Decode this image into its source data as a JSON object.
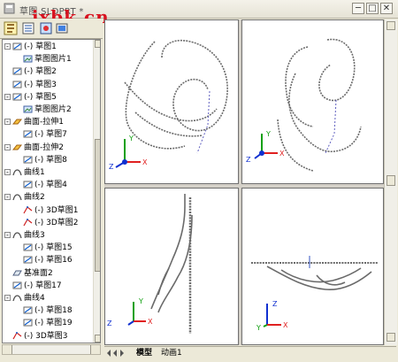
{
  "window": {
    "title": "草图.SLDPRT *",
    "watermark": "jxbk.cn",
    "minimize_label": "─",
    "restore_label": "□",
    "close_label": "✕"
  },
  "toolbar": {
    "buttons": [
      "feature-manager",
      "property-manager",
      "configuration-manager"
    ]
  },
  "tree": {
    "items": [
      {
        "label": "(-) 草图1",
        "icon": "sketch-icon",
        "level": 0,
        "expander": "-"
      },
      {
        "label": "草图图片1",
        "icon": "sketch-picture-icon",
        "level": 1
      },
      {
        "label": "(-) 草图2",
        "icon": "sketch-icon",
        "level": 0
      },
      {
        "label": "(-) 草图3",
        "icon": "sketch-icon",
        "level": 0
      },
      {
        "label": "(-) 草图5",
        "icon": "sketch-icon",
        "level": 0,
        "expander": "-"
      },
      {
        "label": "草图图片2",
        "icon": "sketch-picture-icon",
        "level": 1
      },
      {
        "label": "曲面-拉伸1",
        "icon": "surface-extrude-icon",
        "level": 0,
        "expander": "-"
      },
      {
        "label": "(-) 草图7",
        "icon": "sketch-icon",
        "level": 1
      },
      {
        "label": "曲面-拉伸2",
        "icon": "surface-extrude-icon",
        "level": 0,
        "expander": "-"
      },
      {
        "label": "(-) 草图8",
        "icon": "sketch-icon",
        "level": 1
      },
      {
        "label": "曲线1",
        "icon": "curve-icon",
        "level": 0,
        "expander": "-"
      },
      {
        "label": "(-) 草图4",
        "icon": "sketch-icon",
        "level": 1
      },
      {
        "label": "曲线2",
        "icon": "curve-icon",
        "level": 0,
        "expander": "-"
      },
      {
        "label": "(-) 3D草图1",
        "icon": "3d-sketch-icon",
        "level": 1
      },
      {
        "label": "(-) 3D草图2",
        "icon": "3d-sketch-icon",
        "level": 1
      },
      {
        "label": "曲线3",
        "icon": "curve-icon",
        "level": 0,
        "expander": "-"
      },
      {
        "label": "(-) 草图15",
        "icon": "sketch-icon",
        "level": 1
      },
      {
        "label": "(-) 草图16",
        "icon": "sketch-icon",
        "level": 1
      },
      {
        "label": "基准面2",
        "icon": "plane-icon",
        "level": 0
      },
      {
        "label": "(-) 草图17",
        "icon": "sketch-icon",
        "level": 0
      },
      {
        "label": "曲线4",
        "icon": "curve-icon",
        "level": 0,
        "expander": "-"
      },
      {
        "label": "(-) 草图18",
        "icon": "sketch-icon",
        "level": 1
      },
      {
        "label": "(-) 草图19",
        "icon": "sketch-icon",
        "level": 1
      },
      {
        "label": "(-) 3D草图3",
        "icon": "3d-sketch-icon",
        "level": 0
      }
    ]
  },
  "viewports": [
    {
      "name": "top-left-view"
    },
    {
      "name": "top-right-view"
    },
    {
      "name": "bottom-left-view"
    },
    {
      "name": "bottom-right-view"
    }
  ],
  "axes": {
    "x": "X",
    "y": "Y",
    "z": "Z",
    "x_color": "#e02020",
    "y_color": "#10a010",
    "z_color": "#1030d0"
  },
  "tabs": {
    "model": "模型",
    "motion": "动画1"
  },
  "colors": {
    "curve": "#6a6a6a",
    "frame": "#ece9d8"
  }
}
